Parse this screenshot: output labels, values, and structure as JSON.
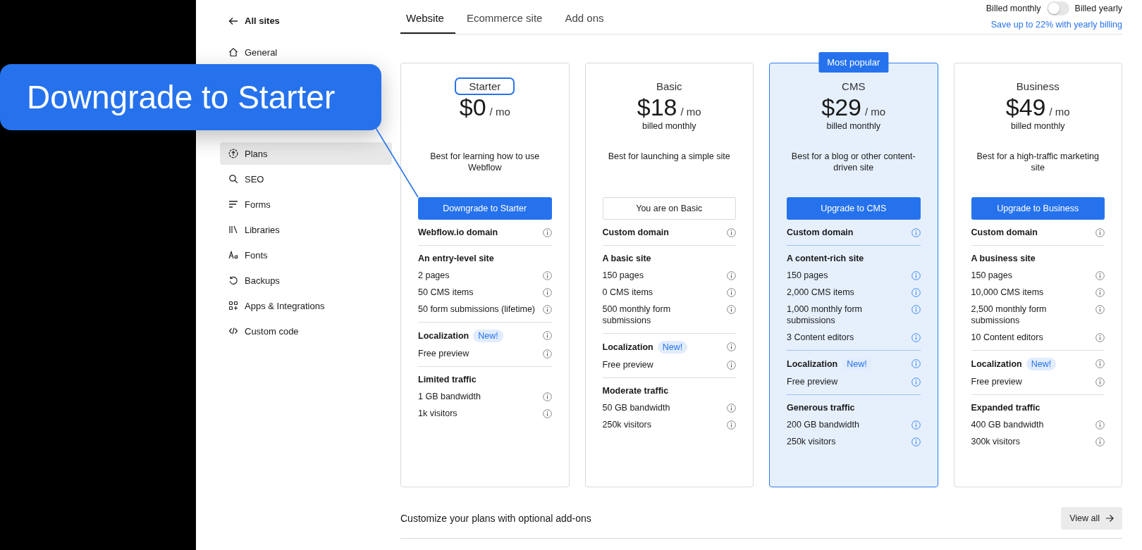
{
  "callout": {
    "text": "Downgrade to Starter"
  },
  "sidebar": {
    "back": "All sites",
    "items": [
      {
        "label": "General",
        "selected": false
      },
      {
        "label": "Plans",
        "selected": true
      },
      {
        "label": "SEO",
        "selected": false
      },
      {
        "label": "Forms",
        "selected": false
      },
      {
        "label": "Libraries",
        "selected": false
      },
      {
        "label": "Fonts",
        "selected": false
      },
      {
        "label": "Backups",
        "selected": false
      },
      {
        "label": "Apps & Integrations",
        "selected": false
      },
      {
        "label": "Custom code",
        "selected": false
      }
    ]
  },
  "tabs": [
    {
      "label": "Website",
      "selected": true
    },
    {
      "label": "Ecommerce site",
      "selected": false
    },
    {
      "label": "Add ons",
      "selected": false
    }
  ],
  "billing": {
    "monthly_label": "Billed monthly",
    "yearly_label": "Billed yearly",
    "yearly": false,
    "savings_link": "Save up to 22% with yearly billing"
  },
  "plans": [
    {
      "name": "Starter",
      "title_highlighted": true,
      "price": "$0",
      "per": "/ mo",
      "description": "Best for learning how to use Webflow",
      "button": {
        "label": "Downgrade to Starter",
        "kind": "primary"
      },
      "featured": false,
      "groups": [
        [
          {
            "text": "Webflow.io domain",
            "bold": true,
            "info": true
          }
        ],
        [
          {
            "text": "An entry-level site",
            "bold": true,
            "info": false
          },
          {
            "text": "2 pages",
            "bold": false,
            "info": true
          },
          {
            "text": "50 CMS items",
            "bold": false,
            "info": true
          },
          {
            "text": "50 form submissions (lifetime)",
            "bold": false,
            "info": true
          }
        ],
        [
          {
            "text": "Localization",
            "badge": "New!",
            "bold": true,
            "info": true
          },
          {
            "text": "Free preview",
            "bold": false,
            "info": true
          }
        ],
        [
          {
            "text": "Limited traffic",
            "bold": true,
            "info": false
          },
          {
            "text": "1 GB bandwidth",
            "bold": false,
            "info": true
          },
          {
            "text": "1k visitors",
            "bold": false,
            "info": true
          }
        ]
      ]
    },
    {
      "name": "Basic",
      "title_highlighted": false,
      "price": "$18",
      "per": "/ mo",
      "billed": "billed monthly",
      "description": "Best for launching a simple site",
      "button": {
        "label": "You are on Basic",
        "kind": "current"
      },
      "featured": false,
      "groups": [
        [
          {
            "text": "Custom domain",
            "bold": true,
            "info": true
          }
        ],
        [
          {
            "text": "A basic site",
            "bold": true,
            "info": false
          },
          {
            "text": "150 pages",
            "bold": false,
            "info": true
          },
          {
            "text": "0 CMS items",
            "bold": false,
            "info": true
          },
          {
            "text": "500 monthly form submissions",
            "bold": false,
            "info": true
          }
        ],
        [
          {
            "text": "Localization",
            "badge": "New!",
            "bold": true,
            "info": true
          },
          {
            "text": "Free preview",
            "bold": false,
            "info": true
          }
        ],
        [
          {
            "text": "Moderate traffic",
            "bold": true,
            "info": false
          },
          {
            "text": "50 GB bandwidth",
            "bold": false,
            "info": true
          },
          {
            "text": "250k visitors",
            "bold": false,
            "info": true
          }
        ]
      ]
    },
    {
      "name": "CMS",
      "title_highlighted": false,
      "badge": "Most popular",
      "price": "$29",
      "per": "/ mo",
      "billed": "billed monthly",
      "description": "Best for a blog or other content-driven site",
      "button": {
        "label": "Upgrade to CMS",
        "kind": "primary"
      },
      "featured": true,
      "groups": [
        [
          {
            "text": "Custom domain",
            "bold": true,
            "info": true
          }
        ],
        [
          {
            "text": "A content-rich site",
            "bold": true,
            "info": false
          },
          {
            "text": "150 pages",
            "bold": false,
            "info": true
          },
          {
            "text": "2,000 CMS items",
            "bold": false,
            "info": true
          },
          {
            "text": "1,000 monthly form submissions",
            "bold": false,
            "info": true
          },
          {
            "text": "3 Content editors",
            "bold": false,
            "info": true
          }
        ],
        [
          {
            "text": "Localization",
            "badge": "New!",
            "bold": true,
            "info": true
          },
          {
            "text": "Free preview",
            "bold": false,
            "info": true
          }
        ],
        [
          {
            "text": "Generous traffic",
            "bold": true,
            "info": false
          },
          {
            "text": "200 GB bandwidth",
            "bold": false,
            "info": true
          },
          {
            "text": "250k visitors",
            "bold": false,
            "info": true
          }
        ]
      ]
    },
    {
      "name": "Business",
      "title_highlighted": false,
      "price": "$49",
      "per": "/ mo",
      "billed": "billed monthly",
      "description": "Best for a high-traffic marketing site",
      "button": {
        "label": "Upgrade to Business",
        "kind": "primary"
      },
      "featured": false,
      "groups": [
        [
          {
            "text": "Custom domain",
            "bold": true,
            "info": true
          }
        ],
        [
          {
            "text": "A business site",
            "bold": true,
            "info": false
          },
          {
            "text": "150 pages",
            "bold": false,
            "info": true
          },
          {
            "text": "10,000 CMS items",
            "bold": false,
            "info": true
          },
          {
            "text": "2,500 monthly form submissions",
            "bold": false,
            "info": true
          },
          {
            "text": "10 Content editors",
            "bold": false,
            "info": true
          }
        ],
        [
          {
            "text": "Localization",
            "badge": "New!",
            "bold": true,
            "info": true
          },
          {
            "text": "Free preview",
            "bold": false,
            "info": true
          }
        ],
        [
          {
            "text": "Expanded traffic",
            "bold": true,
            "info": false
          },
          {
            "text": "400 GB bandwidth",
            "bold": false,
            "info": true
          },
          {
            "text": "300k visitors",
            "bold": false,
            "info": true
          }
        ]
      ]
    }
  ],
  "addons": {
    "title": "Customize your plans with optional add-ons",
    "button": "View all"
  }
}
